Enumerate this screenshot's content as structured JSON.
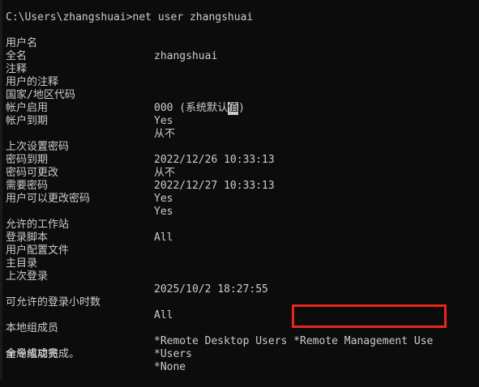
{
  "command": "C:\\Users\\zhangshuai>net user zhangshuai",
  "rows": [
    {
      "label": "用户名",
      "value": "zhangshuai"
    },
    {
      "label": "全名",
      "value": ""
    },
    {
      "label": "注释",
      "value": ""
    },
    {
      "label": "用户的注释",
      "value": ""
    },
    {
      "label": "国家/地区代码",
      "value": "000 (系统默认",
      "cursor": "值",
      "after": ")"
    },
    {
      "label": "帐户启用",
      "value": "Yes"
    },
    {
      "label": "帐户到期",
      "value": "从不"
    },
    {
      "label": "上次设置密码",
      "value": "2022/12/26 10:33:13"
    },
    {
      "label": "密码到期",
      "value": "从不"
    },
    {
      "label": "密码可更改",
      "value": "2022/12/27 10:33:13"
    },
    {
      "label": "需要密码",
      "value": "Yes"
    },
    {
      "label": "用户可以更改密码",
      "value": "Yes"
    },
    {
      "label": "允许的工作站",
      "value": "All"
    },
    {
      "label": "登录脚本",
      "value": ""
    },
    {
      "label": "用户配置文件",
      "value": ""
    },
    {
      "label": "主目录",
      "value": ""
    },
    {
      "label": "上次登录",
      "value": "2025/10/2 18:27:55"
    },
    {
      "label": "可允许的登录小时数",
      "value": "All"
    },
    {
      "label": "本地组成员",
      "value": "*Remote Desktop Users *Remote Management Use"
    },
    {
      "label": "",
      "value": "*Users"
    },
    {
      "label": "全局组成员",
      "value": "*None"
    }
  ],
  "completion": "命令成功完成。",
  "colors": {
    "background": "#0c0c0c",
    "text": "#cccccc",
    "highlight": "#e8261c"
  }
}
